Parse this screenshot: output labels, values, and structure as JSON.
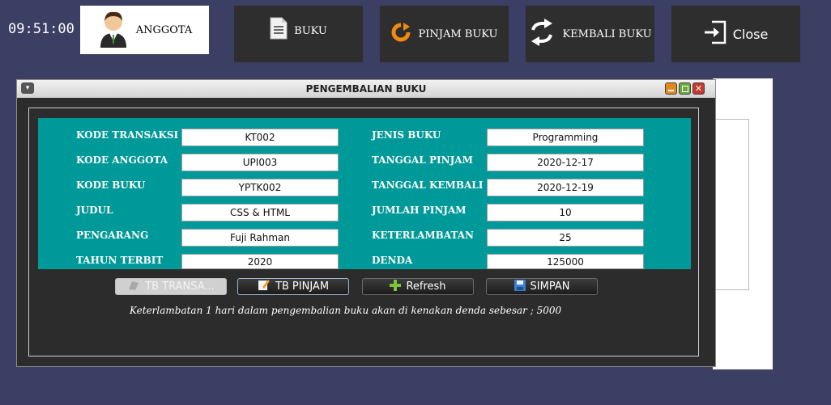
{
  "clock": "09:51:00",
  "nav": {
    "anggota": "ANGGOTA",
    "buku": "BUKU",
    "pinjam": "PINJAM BUKU",
    "kembali": "KEMBALI BUKU",
    "close": "Close"
  },
  "window": {
    "title": "PENGEMBALIAN BUKU"
  },
  "form": {
    "kode_transaksi": {
      "label": "KODE TRANSAKSI",
      "value": "KT002"
    },
    "kode_anggota": {
      "label": "KODE ANGGOTA",
      "value": "UPI003"
    },
    "kode_buku": {
      "label": "KODE BUKU",
      "value": "YPTK002"
    },
    "judul": {
      "label": "JUDUL",
      "value": "CSS & HTML"
    },
    "pengarang": {
      "label": "PENGARANG",
      "value": "Fuji Rahman"
    },
    "tahun_terbit": {
      "label": "TAHUN TERBIT",
      "value": "2020"
    },
    "jenis_buku": {
      "label": "JENIS BUKU",
      "value": "Programming"
    },
    "tanggal_pinjam": {
      "label": "TANGGAL PINJAM",
      "value": "2020-12-17"
    },
    "tanggal_kembali": {
      "label": "TANGGAL KEMBALI",
      "value": "2020-12-19"
    },
    "jumlah_pinjam": {
      "label": "JUMLAH PINJAM",
      "value": "10"
    },
    "keterlambatan": {
      "label": "KETERLAMBATAN",
      "value": "25"
    },
    "denda": {
      "label": "DENDA",
      "value": "125000"
    }
  },
  "buttons": {
    "tb_transaksi": "TB TRANSA...",
    "tb_pinjam": "TB PINJAM",
    "refresh": "Refresh",
    "simpan": "SIMPAN"
  },
  "note": "Keterlambatan 1 hari dalam pengembalian buku akan di kenakan denda sebesar ;  5000",
  "colors": {
    "desktop_bg": "#3a3f63",
    "form_panel": "#009999",
    "window_bg": "#2c2c2c"
  },
  "icons": {
    "anggota": "user-avatar-icon",
    "buku": "document-icon",
    "pinjam": "refresh-orange-icon",
    "kembali": "swap-arrows-icon",
    "close": "exit-icon"
  }
}
